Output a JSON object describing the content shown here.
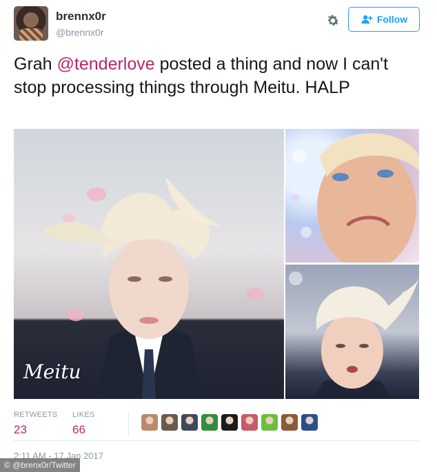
{
  "user": {
    "name": "brennx0r",
    "handle": "@brennx0r"
  },
  "follow_label": "Follow",
  "tweet": {
    "prefix": "Grah ",
    "mention": "@tenderlove",
    "suffix": " posted a thing and now I can't stop processing things through Meitu. HALP"
  },
  "media": {
    "watermark": "Meitu"
  },
  "stats": {
    "retweets_label": "RETWEETS",
    "retweets_count": "23",
    "likes_label": "LIKES",
    "likes_count": "66"
  },
  "likers": [
    {
      "icon": "liker-avatar",
      "color": "#b98a6a"
    },
    {
      "icon": "liker-avatar",
      "color": "#6b5a4e"
    },
    {
      "icon": "liker-avatar",
      "color": "#3d4a5c"
    },
    {
      "icon": "liker-avatar",
      "color": "#2f8f3a"
    },
    {
      "icon": "liker-avatar",
      "color": "#1b1b1b"
    },
    {
      "icon": "liker-avatar",
      "color": "#c85a6a"
    },
    {
      "icon": "liker-avatar",
      "color": "#6cbf3a"
    },
    {
      "icon": "liker-avatar",
      "color": "#8a5a3a"
    },
    {
      "icon": "liker-avatar",
      "color": "#2a4f8f"
    }
  ],
  "timestamp": "2:11 AM - 17 Jan 2017",
  "credit": "© @brenx0r/Twitter",
  "colors": {
    "accent": "#1da1f2",
    "mention": "#b5286a",
    "muted": "#8899a6"
  }
}
